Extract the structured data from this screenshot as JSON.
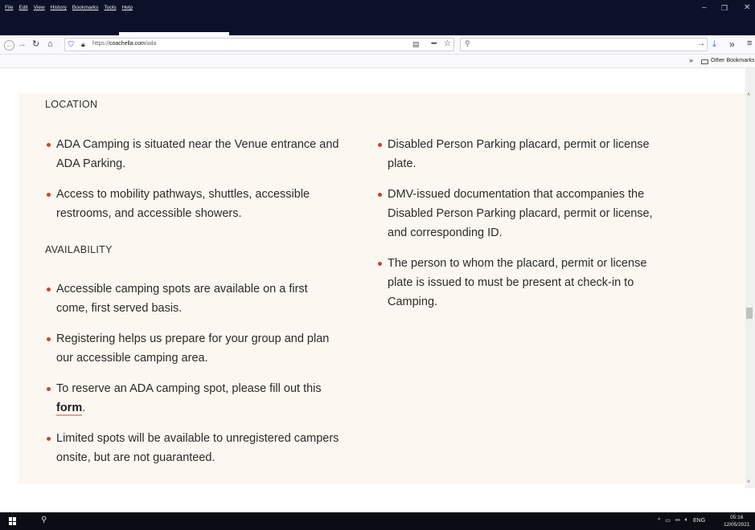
{
  "browser": {
    "menu": [
      "File",
      "Edit",
      "View",
      "History",
      "Bookmarks",
      "Tools",
      "Help"
    ],
    "url_prefix": "https://",
    "url_domain": "coachella.com",
    "url_path": "/ada",
    "bookmarks_label": "Other Bookmarks"
  },
  "page": {
    "location_heading": "LOCATION",
    "location_items": [
      "ADA Camping is situated near the Venue entrance and ADA Parking.",
      "Access to mobility pathways, shuttles, accessible restrooms, and accessible showers."
    ],
    "availability_heading": "AVAILABILITY",
    "availability_items": [
      "Accessible camping spots are available on a first come, first served basis.",
      "Registering helps us prepare for your group and plan our accessible camping area."
    ],
    "reserve_text": "To reserve an ADA camping spot, please fill out this ",
    "reserve_link": "form",
    "reserve_end": ".",
    "limited_item": "Limited spots will be available to unregistered campers onsite, but are not guaranteed.",
    "right_items": [
      "Disabled Person Parking placard, permit or license plate.",
      "DMV-issued documentation that accompanies the Disabled Person Parking placard, permit or license, and corresponding ID.",
      "The person to whom the placard, permit or license plate is issued to must be present at check-in to Camping."
    ]
  },
  "taskbar": {
    "language": "ENG",
    "time": "05:16",
    "date": "12/05/2021"
  },
  "colors": {
    "bullet": "#c8442e",
    "panel_bg": "#fcf8f1",
    "titlebar_bg": "#0c1029"
  }
}
